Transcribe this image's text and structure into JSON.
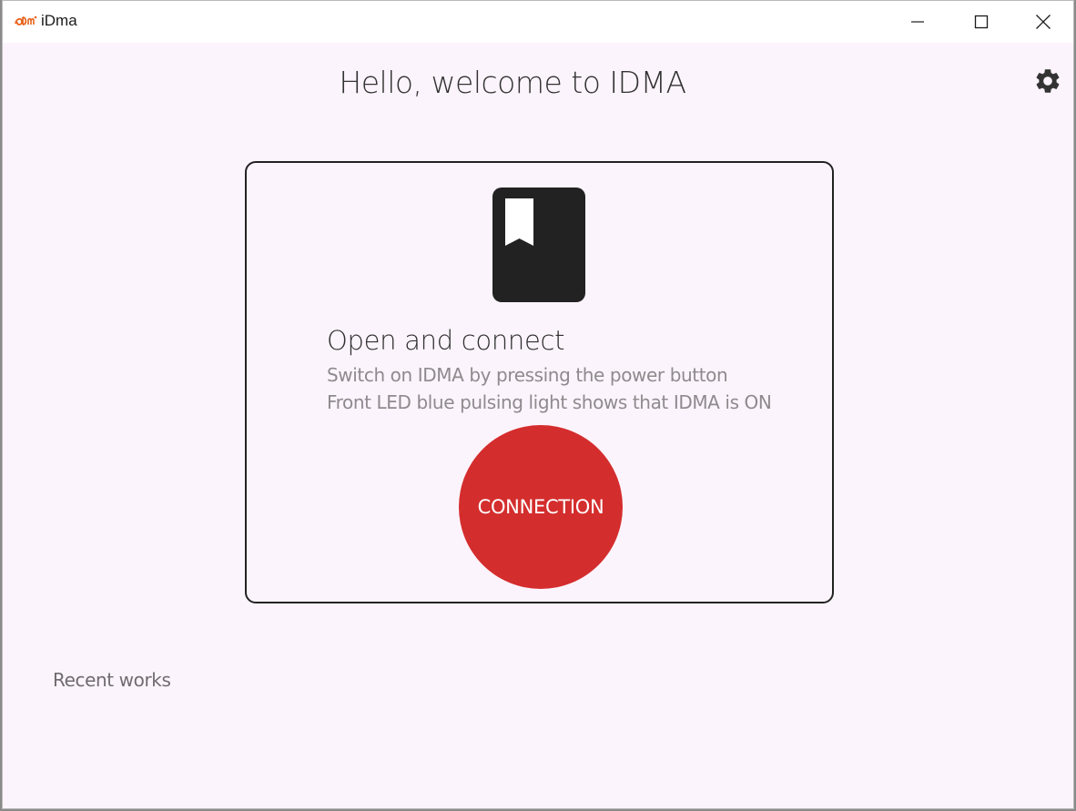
{
  "window": {
    "title": "iDma",
    "logo_icon": "idma-logo-icon",
    "controls": [
      "minimize-icon",
      "maximize-icon",
      "close-icon"
    ]
  },
  "header": {
    "welcome": "Hello, welcome to IDMA",
    "settings_icon": "gear-icon"
  },
  "card": {
    "icon": "bookmark-book-icon",
    "title": "Open and connect",
    "line1": "Switch on IDMA by pressing the power button",
    "line2": "Front LED blue pulsing light shows that IDMA is ON",
    "button_label": "CONNECTION"
  },
  "recent": {
    "label": "Recent works"
  },
  "colors": {
    "background": "#fcf4fc",
    "accent": "#d42d2d",
    "icon_dark": "#222222",
    "logo_orange": "#e8631c"
  }
}
